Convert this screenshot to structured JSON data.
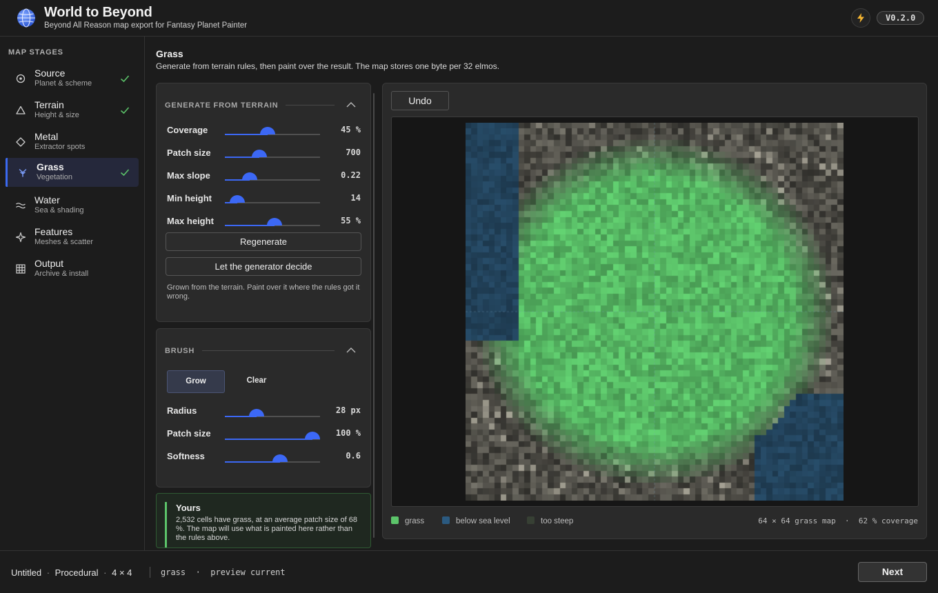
{
  "header": {
    "title": "World to Beyond",
    "subtitle": "Beyond All Reason map export for Fantasy Planet Painter",
    "version": "V0.2.0"
  },
  "sidebar": {
    "heading": "MAP STAGES",
    "items": [
      {
        "name": "Source",
        "desc": "Planet & scheme",
        "icon": "target-icon",
        "done": true
      },
      {
        "name": "Terrain",
        "desc": "Height & size",
        "icon": "triangle-icon",
        "done": true
      },
      {
        "name": "Metal",
        "desc": "Extractor spots",
        "icon": "diamond-icon",
        "done": false
      },
      {
        "name": "Grass",
        "desc": "Vegetation",
        "icon": "sprout-icon",
        "done": true,
        "active": true
      },
      {
        "name": "Water",
        "desc": "Sea & shading",
        "icon": "waves-icon",
        "done": false
      },
      {
        "name": "Features",
        "desc": "Meshes & scatter",
        "icon": "sparkle-icon",
        "done": false
      },
      {
        "name": "Output",
        "desc": "Archive & install",
        "icon": "grid-icon",
        "done": false
      }
    ]
  },
  "main": {
    "title": "Grass",
    "description": "Generate from terrain rules, then paint over the result. The map stores one byte per 32 elmos."
  },
  "generate": {
    "heading": "GENERATE FROM TERRAIN",
    "sliders": [
      {
        "label": "Coverage",
        "value": "45 %",
        "fraction": 0.45
      },
      {
        "label": "Patch size",
        "value": "700",
        "fraction": 0.36
      },
      {
        "label": "Max slope",
        "value": "0.22",
        "fraction": 0.26
      },
      {
        "label": "Min height",
        "value": "14",
        "fraction": 0.13
      },
      {
        "label": "Max height",
        "value": "55 %",
        "fraction": 0.52
      }
    ],
    "regenerate_label": "Regenerate",
    "auto_label": "Let the generator decide",
    "note": "Grown from the terrain. Paint over it where the rules got it wrong."
  },
  "brush": {
    "heading": "BRUSH",
    "modes": [
      "Grow",
      "Clear"
    ],
    "sliders": [
      {
        "label": "Radius",
        "value": "28 px",
        "fraction": 0.33
      },
      {
        "label": "Patch size",
        "value": "100 %",
        "fraction": 0.92
      },
      {
        "label": "Softness",
        "value": "0.6",
        "fraction": 0.58
      }
    ]
  },
  "yours": {
    "title": "Yours",
    "text": "2,532 cells have grass, at an average patch size of 68 %. The map will use what is painted here rather than the rules above."
  },
  "preview": {
    "undo_label": "Undo",
    "legend": [
      {
        "label": "grass",
        "color": "#5cc46a"
      },
      {
        "label": "below sea level",
        "color": "#2b5a80"
      },
      {
        "label": "too steep",
        "color": "#374034"
      }
    ],
    "stats": "64 × 64 grass map  ·  62 % coverage"
  },
  "footer": {
    "project": "Untitled",
    "source": "Procedural",
    "size": "4 × 4",
    "status": "grass  ·  preview current",
    "next_label": "Next"
  },
  "colors": {
    "accent": "#3c68f5",
    "grass": "#5cc46a",
    "water": "#2b5a80",
    "steep": "#374034"
  }
}
